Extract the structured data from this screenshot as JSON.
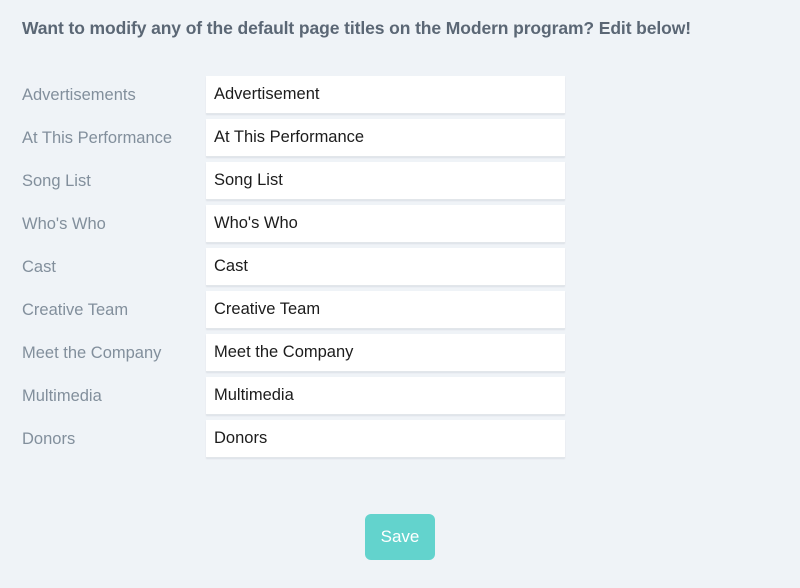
{
  "page": {
    "heading": "Want to modify any of the default page titles on the Modern program? Edit below!",
    "background_color": "#eff3f7",
    "heading_color": "#5b6775",
    "label_color": "#828f9c",
    "input_text_color": "#1c1c1c",
    "accent_color": "#63d3cd"
  },
  "form": {
    "rows": [
      {
        "label": "Advertisements",
        "value": "Advertisement",
        "placeholder": "Advertisements"
      },
      {
        "label": "At This Performance",
        "value": "At This Performance",
        "placeholder": "At This Performance"
      },
      {
        "label": "Song List",
        "value": "Song List",
        "placeholder": "Song List"
      },
      {
        "label": "Who's Who",
        "value": "Who's Who",
        "placeholder": "Who's Who"
      },
      {
        "label": "Cast",
        "value": "Cast",
        "placeholder": "Cast"
      },
      {
        "label": "Creative Team",
        "value": "Creative Team",
        "placeholder": "Creative Team"
      },
      {
        "label": "Meet the Company",
        "value": "Meet the Company",
        "placeholder": "Meet the Company"
      },
      {
        "label": "Multimedia",
        "value": "Multimedia",
        "placeholder": "Multimedia"
      },
      {
        "label": "Donors",
        "value": "Donors",
        "placeholder": "Donors"
      }
    ]
  },
  "actions": {
    "save_label": "Save"
  }
}
